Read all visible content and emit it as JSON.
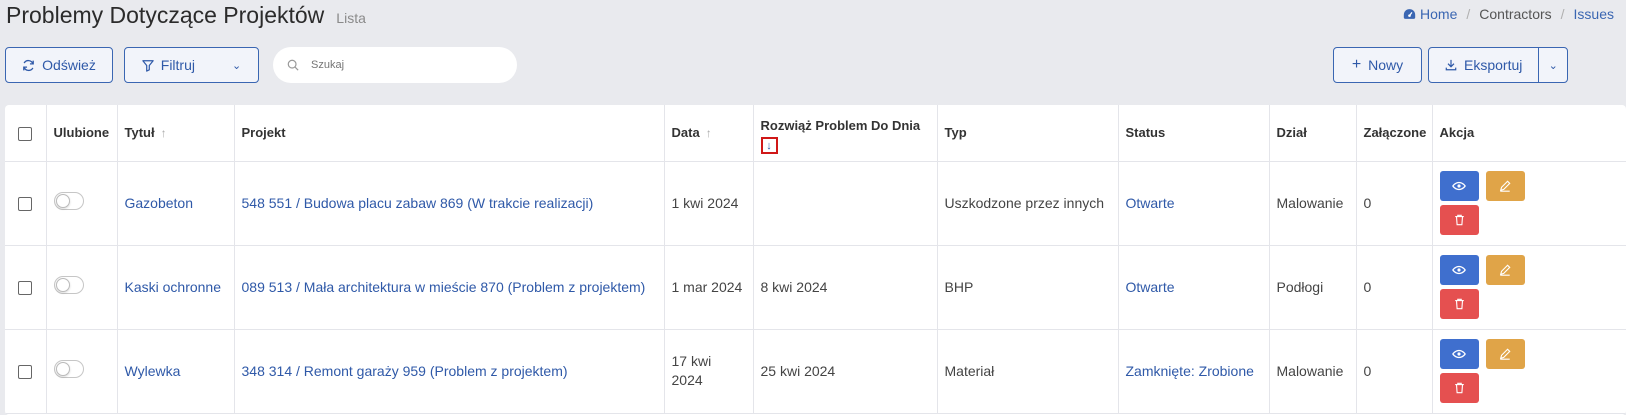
{
  "header": {
    "title": "Problemy Dotyczące Projektów",
    "subtitle": "Lista"
  },
  "breadcrumb": [
    {
      "label": "Home",
      "icon": "dashboard-icon"
    },
    {
      "label": "Contractors"
    },
    {
      "label": "Issues"
    }
  ],
  "toolbar": {
    "refresh_label": "Odśwież",
    "filter_label": "Filtruj",
    "search_placeholder": "Szukaj",
    "new_label": "Nowy",
    "export_label": "Eksportuj"
  },
  "table": {
    "columns": {
      "favorite": "Ulubione",
      "title": "Tytuł",
      "project": "Projekt",
      "date": "Data",
      "due": "Rozwiąż Problem Do Dnia",
      "type": "Typ",
      "status": "Status",
      "department": "Dział",
      "attached": "Załączone",
      "action": "Akcja"
    },
    "rows": [
      {
        "title": "Gazobeton",
        "project": "548 551 / Budowa placu zabaw 869 (W trakcie realizacji)",
        "date": "1 kwi 2024",
        "due": "",
        "type": "Uszkodzone przez innych",
        "status": "Otwarte",
        "department": "Malowanie",
        "attached": "0"
      },
      {
        "title": "Kaski ochronne",
        "project": "089 513 / Mała architektura w mieście 870 (Problem z projektem)",
        "date": "1 mar 2024",
        "due": "8 kwi 2024",
        "type": "BHP",
        "status": "Otwarte",
        "department": "Podłogi",
        "attached": "0"
      },
      {
        "title": "Wylewka",
        "project": "348 314 / Remont garaży 959 (Problem z projektem)",
        "date": "17 kwi 2024",
        "due": "25 kwi 2024",
        "type": "Materiał",
        "status": "Zamknięte: Zrobione",
        "department": "Malowanie",
        "attached": "0"
      }
    ]
  },
  "colors": {
    "accent": "#2f59a8",
    "view": "#3f6fce",
    "edit": "#e0a448",
    "delete": "#e55050",
    "highlight": "#d01818"
  }
}
